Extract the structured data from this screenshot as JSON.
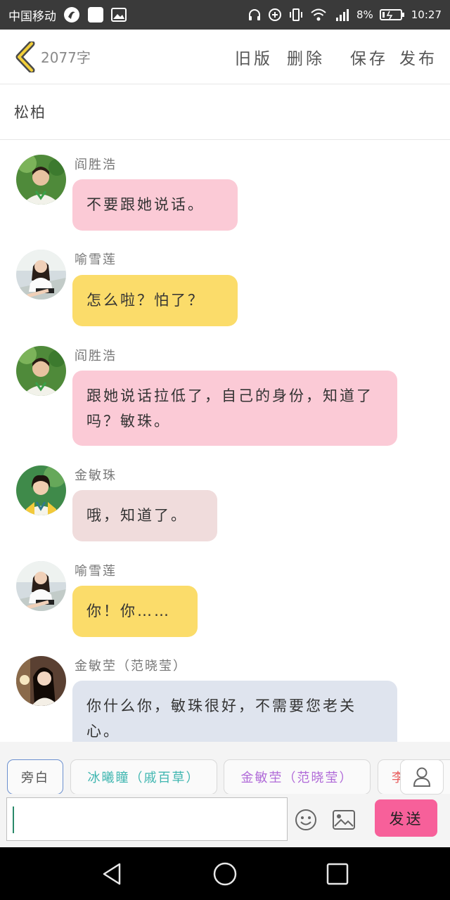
{
  "status_bar": {
    "carrier": "中国移动",
    "battery": "8%",
    "time": "10:27",
    "icons": [
      "app-icon",
      "square-icon",
      "image-icon",
      "headphones-icon",
      "add-circle-icon",
      "vibrate-icon",
      "wifi-icon",
      "signal-icon",
      "battery-icon"
    ]
  },
  "header": {
    "word_count": "2077字",
    "actions": {
      "old_version": "旧版",
      "delete": "删除",
      "save": "保存",
      "publish": "发布"
    }
  },
  "title": "松柏",
  "messages": [
    {
      "name": "阎胜浩",
      "text": "不要跟她说话。",
      "bubble_color": "#fbcad6",
      "avatar": "male"
    },
    {
      "name": "喻雪莲",
      "text": "怎么啦？怕了？",
      "bubble_color": "#fbdc6a",
      "avatar": "female-white"
    },
    {
      "name": "阎胜浩",
      "text": "跟她说话拉低了，自己的身份，知道了吗？敏珠。",
      "bubble_color": "#fbcad6",
      "avatar": "male"
    },
    {
      "name": "金敏珠",
      "text": "哦，知道了。",
      "bubble_color": "#f0dcdc",
      "avatar": "female-green"
    },
    {
      "name": "喻雪莲",
      "text": "你！你……",
      "bubble_color": "#fbdc6a",
      "avatar": "female-white"
    },
    {
      "name": "金敏茔（范晓莹）",
      "text": "你什么你，敏珠很好，不需要您老关心。",
      "bubble_color": "#dfe4ee",
      "avatar": "female-dark"
    }
  ],
  "toolbar": {
    "roles": [
      {
        "label": "旁白",
        "color": "#555555"
      },
      {
        "label": "冰曦瞳（戚百草）",
        "color": "#3fb6b0"
      },
      {
        "label": "金敏茔（范晓莹）",
        "color": "#b06ad8"
      },
      {
        "label": "李",
        "color": "#e85c5c"
      }
    ],
    "send_label": "发送",
    "accent": "#f7609a"
  },
  "navbar": {
    "icons": [
      "back-triangle-icon",
      "home-circle-icon",
      "recents-square-icon"
    ]
  }
}
